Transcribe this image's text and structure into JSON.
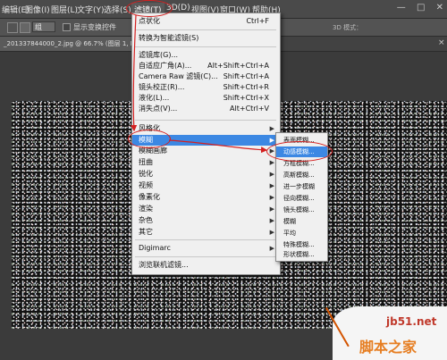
{
  "menubar": {
    "items": [
      "编辑(E)",
      "图像(I)",
      "图层(L)",
      "文字(Y)",
      "选择(S)",
      "滤镜(T)",
      "3D(D)",
      "视图(V)",
      "窗口(W)",
      "帮助(H)"
    ],
    "window_min": "—",
    "window_max": "□",
    "window_close": "✕"
  },
  "options": {
    "mode_select": "组",
    "show_transform_label": "显示变换控件",
    "mode_3d": "3D 模式："
  },
  "document_tab": {
    "title": "_201337844000_2.jpg @ 66.7% (图层 1, RGB/",
    "close": "×"
  },
  "filter_menu": {
    "items": [
      {
        "label": "点状化",
        "shortcut": "Ctrl+F"
      },
      {
        "label": "转换为智能滤镜(S)",
        "shortcut": ""
      },
      {
        "label": "滤镜库(G)...",
        "shortcut": ""
      },
      {
        "label": "自适应广角(A)...",
        "shortcut": "Alt+Shift+Ctrl+A"
      },
      {
        "label": "Camera Raw 滤镜(C)...",
        "shortcut": "Shift+Ctrl+A"
      },
      {
        "label": "镜头校正(R)...",
        "shortcut": "Shift+Ctrl+R"
      },
      {
        "label": "液化(L)...",
        "shortcut": "Shift+Ctrl+X"
      },
      {
        "label": "消失点(V)...",
        "shortcut": "Alt+Ctrl+V"
      },
      {
        "label": "风格化",
        "shortcut": ""
      },
      {
        "label": "模糊",
        "shortcut": ""
      },
      {
        "label": "模糊画廊",
        "shortcut": ""
      },
      {
        "label": "扭曲",
        "shortcut": ""
      },
      {
        "label": "锐化",
        "shortcut": ""
      },
      {
        "label": "视频",
        "shortcut": ""
      },
      {
        "label": "像素化",
        "shortcut": ""
      },
      {
        "label": "渲染",
        "shortcut": ""
      },
      {
        "label": "杂色",
        "shortcut": ""
      },
      {
        "label": "其它",
        "shortcut": ""
      },
      {
        "label": "Digimarc",
        "shortcut": ""
      },
      {
        "label": "浏览联机滤镜...",
        "shortcut": ""
      }
    ]
  },
  "blur_submenu": {
    "items": [
      "表面模糊...",
      "动感模糊...",
      "方框模糊...",
      "高斯模糊...",
      "进一步模糊",
      "径向模糊...",
      "镜头模糊...",
      "模糊",
      "平均",
      "特殊模糊...",
      "形状模糊..."
    ]
  },
  "watermark": {
    "url": "jb51.net",
    "name": "脚本之家"
  },
  "colors": {
    "highlight": "#3c88e3",
    "annotation": "#d42020"
  }
}
